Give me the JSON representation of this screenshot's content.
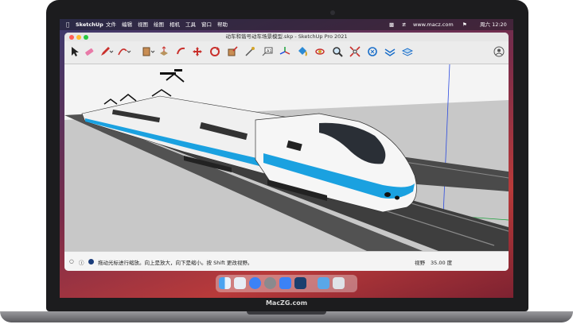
{
  "menubar": {
    "app_name": "SketchUp",
    "items": [
      "文件",
      "编辑",
      "视图",
      "绘图",
      "相机",
      "工具",
      "窗口",
      "帮助"
    ],
    "site": "www.macz.com",
    "clock": "周六 12:20"
  },
  "window": {
    "title": "动车和谐号动车场景模型.skp - SketchUp Pro 2021"
  },
  "toolbar": {
    "tools": [
      "select-tool",
      "eraser-tool",
      "pencil-tool",
      "arc-tool",
      "rectangle-tool",
      "push-pull-tool",
      "move-tool",
      "rotate-tool",
      "scale-tool",
      "offset-tool",
      "tape-measure-tool",
      "text-tool",
      "axes-tool",
      "paint-bucket-tool",
      "orbit-tool",
      "zoom-tool",
      "zoom-extents-tool",
      "warehouse-tool",
      "extension-tool",
      "layout-tool",
      "account-icon"
    ]
  },
  "status": {
    "hint": "拖动光标进行缩放。向上是放大，向下是缩小。按 Shift 更改视野。",
    "field_label": "视野",
    "field_value": "35.00 度"
  },
  "brand": "MacZG.com",
  "colors": {
    "accent": "#1aa1e0",
    "train_body": "#f4f4f4",
    "ground": "#c9c9c9"
  }
}
